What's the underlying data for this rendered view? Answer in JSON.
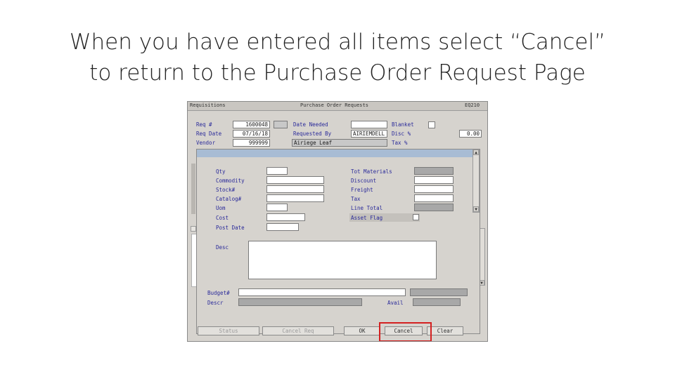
{
  "slide": {
    "title_line1": "When you have entered all items select “Cancel”",
    "title_line2": "to return to the Purchase Order Request Page"
  },
  "window": {
    "left_title": "Requisitions",
    "center_title": "Purchase Order Requests",
    "right_code": "EQ210"
  },
  "header": {
    "req_label": "Req #",
    "req_value": "1600048",
    "req_date_label": "Req Date",
    "req_date_value": "07/16/18",
    "vendor_label": "Vendor",
    "vendor_value": "999999",
    "date_needed_label": "Date Needed",
    "requested_by_label": "Requested By",
    "requested_by_value": "AIRIEMDELL",
    "descriptor_value": "Airiege Leaf",
    "blanket_label": "Blanket",
    "disc_label": "Disc %",
    "disc_value": "0.00",
    "tax_label": "Tax %"
  },
  "item": {
    "qty_label": "Qty",
    "commodity_label": "Commodity",
    "stock_label": "Stock#",
    "catalog_label": "Catalog#",
    "uom_label": "Uom",
    "cost_label": "Cost",
    "post_date_label": "Post Date",
    "tot_materials_label": "Tot Materials",
    "discount_label": "Discount",
    "freight_label": "Freight",
    "tax_label": "Tax",
    "line_total_label": "Line Total",
    "asset_flag_label": "Asset Flag",
    "desc_label": "Desc"
  },
  "footer": {
    "budget_label": "Budget#",
    "descr_label": "Descr",
    "avail_label": "Avail"
  },
  "buttons": {
    "status": "Status",
    "cancel_req": "Cancel Req",
    "ok": "OK",
    "cancel": "Cancel",
    "clear": "Clear"
  },
  "colors": {
    "highlight_box": "#d42020",
    "label_text": "#2a2a9a",
    "panel_bg": "#d6d3ce"
  }
}
